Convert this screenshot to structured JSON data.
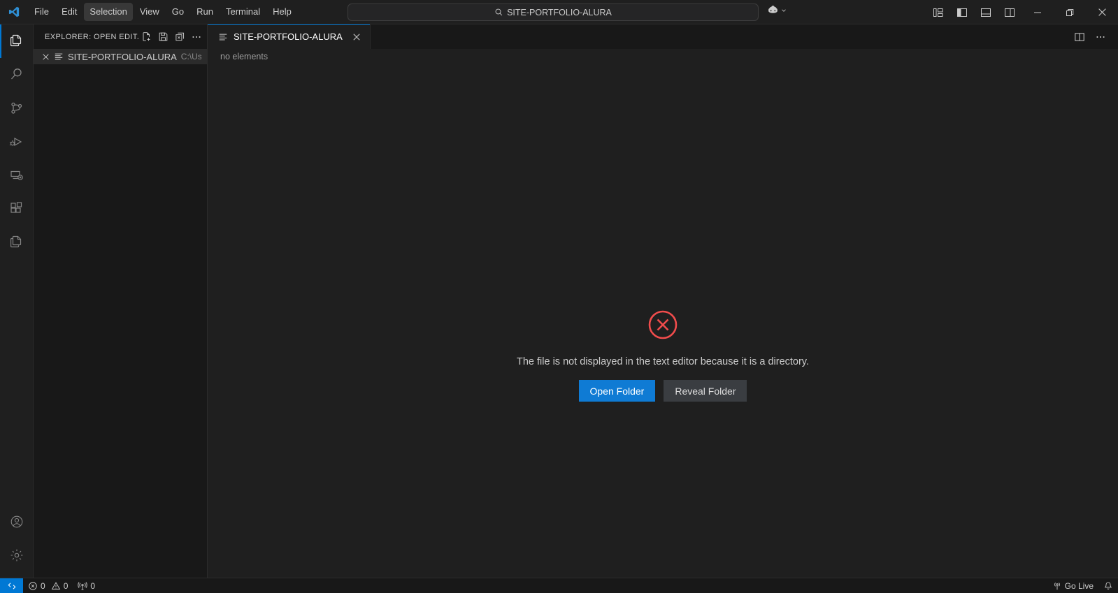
{
  "titlebar": {
    "logo_icon": "vscode-logo-icon",
    "menus": [
      {
        "label": "File",
        "active": false
      },
      {
        "label": "Edit",
        "active": false
      },
      {
        "label": "Selection",
        "active": true
      },
      {
        "label": "View",
        "active": false
      },
      {
        "label": "Go",
        "active": false
      },
      {
        "label": "Run",
        "active": false
      },
      {
        "label": "Terminal",
        "active": false
      },
      {
        "label": "Help",
        "active": false
      }
    ],
    "nav": {
      "back_icon": "arrow-left-icon",
      "forward_icon": "arrow-right-icon"
    },
    "search": {
      "value": "SITE-PORTFOLIO-ALURA",
      "placeholder": "SITE-PORTFOLIO-ALURA",
      "icon": "search-icon"
    },
    "copilot": {
      "icon": "copilot-icon",
      "chevron": "chevron-down-icon"
    },
    "layout_controls": [
      {
        "name": "customize-layout",
        "icon": "customize-layout-icon"
      },
      {
        "name": "toggle-primary-sidebar",
        "icon": "layout-sidebar-left-icon"
      },
      {
        "name": "toggle-panel",
        "icon": "layout-panel-icon"
      },
      {
        "name": "toggle-secondary-sidebar",
        "icon": "layout-sidebar-right-icon"
      }
    ],
    "window_controls": [
      {
        "name": "minimize",
        "icon": "minimize-icon"
      },
      {
        "name": "restore",
        "icon": "restore-icon"
      },
      {
        "name": "close",
        "icon": "close-icon"
      }
    ]
  },
  "activitybar": {
    "top": [
      {
        "name": "explorer",
        "icon": "files-icon",
        "active": true
      },
      {
        "name": "search",
        "icon": "search-icon",
        "active": false
      },
      {
        "name": "source-control",
        "icon": "source-control-icon",
        "active": false
      },
      {
        "name": "run-and-debug",
        "icon": "debug-alt-icon",
        "active": false
      },
      {
        "name": "remote-explorer",
        "icon": "remote-explorer-icon",
        "active": false
      },
      {
        "name": "extensions",
        "icon": "extensions-icon",
        "active": false
      },
      {
        "name": "file-copy",
        "icon": "files-icon",
        "active": false
      }
    ],
    "bottom": [
      {
        "name": "accounts",
        "icon": "account-icon"
      },
      {
        "name": "manage-settings",
        "icon": "gear-icon"
      }
    ]
  },
  "sidebar": {
    "title": "EXPLORER: OPEN EDIT...",
    "actions": [
      {
        "name": "new-untitled-file",
        "icon": "new-file-icon"
      },
      {
        "name": "save-all",
        "icon": "save-all-icon"
      },
      {
        "name": "close-all-editors",
        "icon": "close-all-icon"
      },
      {
        "name": "views-and-more-actions",
        "icon": "ellipsis-icon"
      }
    ],
    "open_editors": [
      {
        "close_icon": "close-icon",
        "file_icon": "directory-list-icon",
        "label": "SITE-PORTFOLIO-ALURA",
        "path": "C:\\Use..."
      }
    ]
  },
  "editor": {
    "tabs": [
      {
        "label": "SITE-PORTFOLIO-ALURA",
        "icon": "directory-list-icon",
        "close_icon": "close-icon",
        "active": true
      }
    ],
    "tabbar_actions": [
      {
        "name": "split-editor-right",
        "icon": "split-editor-icon"
      },
      {
        "name": "more-actions",
        "icon": "ellipsis-icon"
      }
    ],
    "breadcrumbs": "no elements",
    "placeholder": {
      "icon": "error-circle-x-icon",
      "icon_color": "#f14c4c",
      "message": "The file is not displayed in the text editor because it is a directory.",
      "buttons": [
        {
          "label": "Open Folder",
          "style": "primary",
          "color": "#0f7bd4"
        },
        {
          "label": "Reveal Folder",
          "style": "secondary",
          "color": "#3a3d41"
        }
      ]
    }
  },
  "statusbar": {
    "remote": {
      "icon": "remote-icon",
      "color": "#0078d4"
    },
    "problems": {
      "error_icon": "error-icon",
      "error_count": "0",
      "warning_icon": "warning-icon",
      "warning_count": "0"
    },
    "ports": {
      "icon": "radio-tower-icon",
      "count": "0"
    },
    "go_live": {
      "icon": "broadcast-icon",
      "label": "Go Live"
    },
    "notifications": {
      "icon": "bell-icon"
    }
  }
}
